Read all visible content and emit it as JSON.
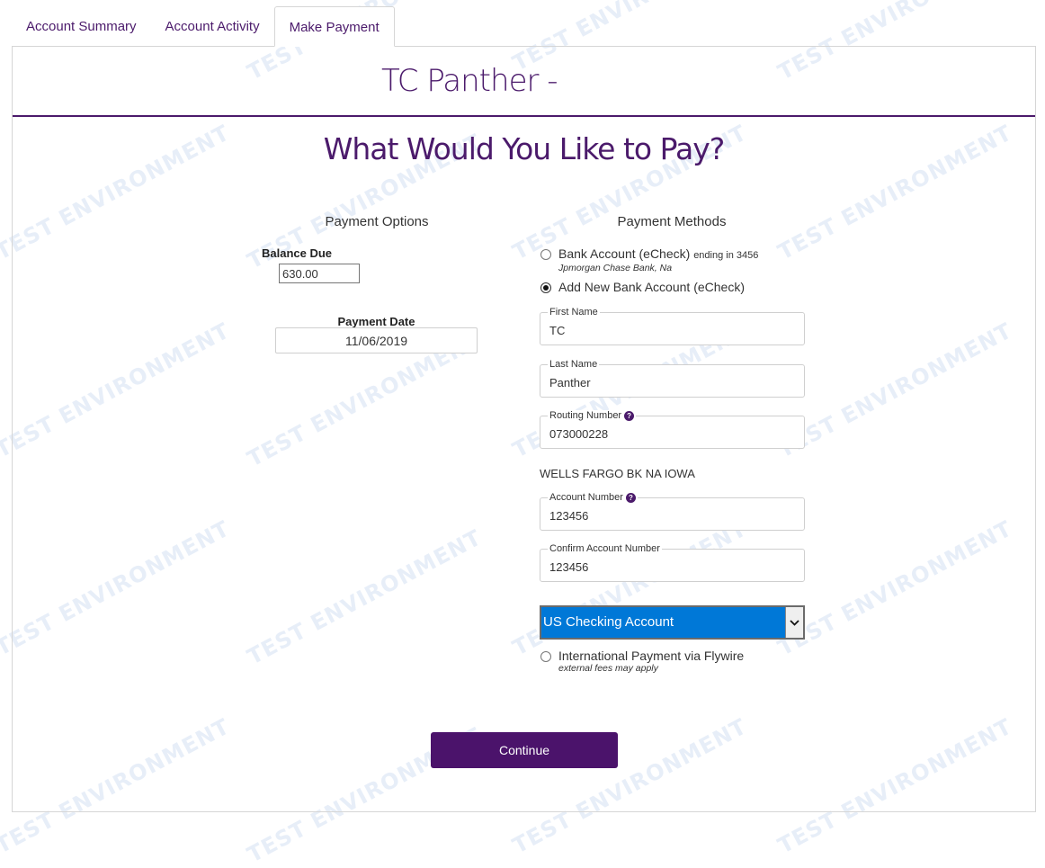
{
  "tabs": [
    {
      "label": "Account Summary",
      "active": false
    },
    {
      "label": "Account Activity",
      "active": false
    },
    {
      "label": "Make Payment",
      "active": true
    }
  ],
  "watermark_text": "TEST ENVIRONMENT",
  "header": {
    "account_title": "TC Panther -"
  },
  "page_heading": "What Would You Like to Pay?",
  "payment_options": {
    "heading": "Payment Options",
    "balance_due_label": "Balance Due",
    "balance_due_value": "630.00",
    "payment_date_label": "Payment Date",
    "payment_date_value": "11/06/2019"
  },
  "payment_methods": {
    "heading": "Payment Methods",
    "existing_bank": {
      "label": "Bank Account (eCheck)",
      "suffix": "ending in 3456",
      "bank_name": "Jpmorgan Chase Bank, Na",
      "selected": false
    },
    "add_new_bank": {
      "label": "Add New Bank Account (eCheck)",
      "selected": true
    },
    "fields": {
      "first_name": {
        "label": "First Name",
        "value": "TC"
      },
      "last_name": {
        "label": "Last Name",
        "value": "Panther"
      },
      "routing_number": {
        "label": "Routing Number",
        "value": "073000228",
        "help_icon": "question-circle-icon"
      },
      "routing_bank_name": "WELLS FARGO BK NA IOWA",
      "account_number": {
        "label": "Account Number",
        "value": "123456",
        "help_icon": "question-circle-icon"
      },
      "confirm_account_number": {
        "label": "Confirm Account Number",
        "value": "123456"
      }
    },
    "account_type": {
      "selected": "US Checking Account"
    },
    "international": {
      "label": "International Payment via Flywire",
      "note": "external fees may apply",
      "selected": false
    }
  },
  "continue_label": "Continue",
  "colors": {
    "brand_purple": "#4b136b",
    "select_highlight": "#0078d7"
  }
}
